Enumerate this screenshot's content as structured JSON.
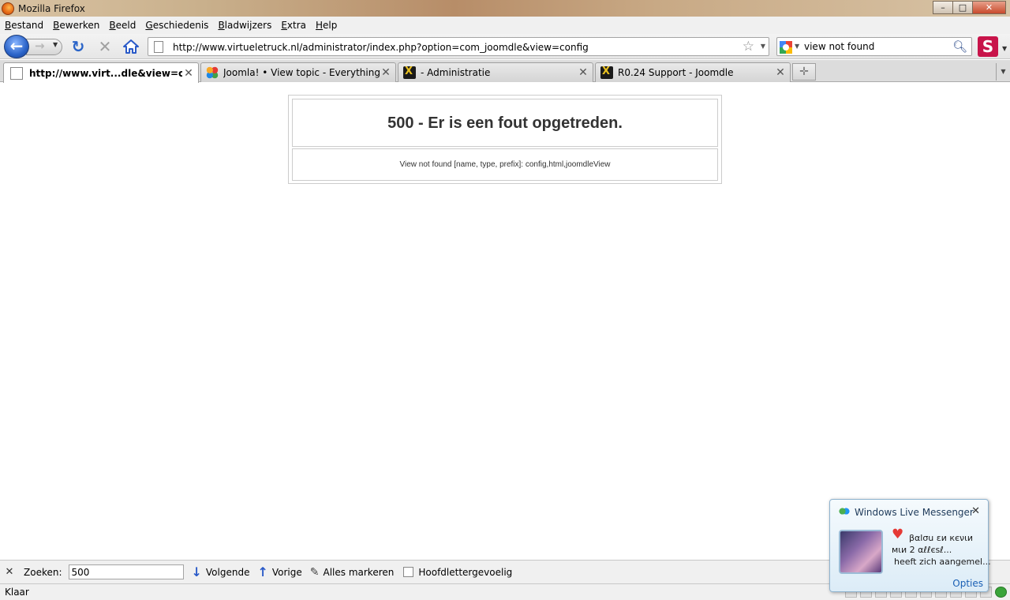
{
  "window": {
    "title": "Mozilla Firefox",
    "minimize": "–",
    "maximize": "□",
    "close": "✕"
  },
  "menu": [
    "Bestand",
    "Bewerken",
    "Beeld",
    "Geschiedenis",
    "Bladwijzers",
    "Extra",
    "Help"
  ],
  "nav": {
    "url": "http://www.virtueletruck.nl/administrator/index.php?option=com_joomdle&view=config",
    "search_value": "view not found",
    "ext_label": "S"
  },
  "tabs": [
    {
      "label": "http://www.virt...dle&view=config",
      "icon": "page-icon",
      "active": true
    },
    {
      "label": "Joomla! • View topic - Everything fe...",
      "icon": "joomla-icon",
      "active": false
    },
    {
      "label": "- Administratie",
      "icon": "joomle-icon",
      "active": false
    },
    {
      "label": "R0.24 Support - Joomdle",
      "icon": "joomle-icon",
      "active": false
    }
  ],
  "content": {
    "error_title": "500 - Er is een fout opgetreden.",
    "error_message": "View not found [name, type, prefix]: config,html,joomdleView"
  },
  "findbar": {
    "label": "Zoeken:",
    "value": "500",
    "next_label": "Volgende",
    "prev_label": "Vorige",
    "highlight_label": "Alles markeren",
    "match_case_label": "Hoofdlettergevoelig"
  },
  "status": {
    "text": "Klaar"
  },
  "messenger": {
    "title": "Windows Live Messenger",
    "line1": "βαlσu εи кєνιи",
    "line2": "мιи 2 αℓℓєѕℓ...",
    "line3": "heeft zich aangemel...",
    "options_label": "Opties"
  }
}
